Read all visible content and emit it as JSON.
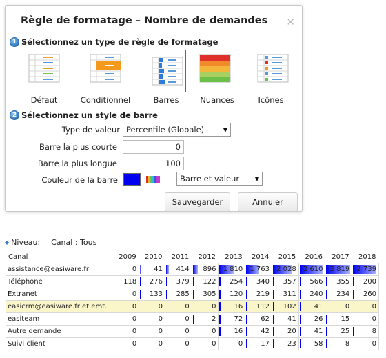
{
  "dialog": {
    "title": "Règle de formatage – Nombre de demandes",
    "close_glyph": "✕",
    "step1": {
      "num": "1",
      "label": "Sélectionnez un type de règle de formatage"
    },
    "step2": {
      "num": "2",
      "label": "Sélectionnez un style de barre"
    },
    "rule_types": [
      {
        "label": "Défaut",
        "icon": "default-format-icon"
      },
      {
        "label": "Conditionnel",
        "icon": "conditional-format-icon"
      },
      {
        "label": "Barres",
        "icon": "bars-format-icon",
        "selected": true
      },
      {
        "label": "Nuances",
        "icon": "shades-format-icon"
      },
      {
        "label": "Icônes",
        "icon": "icons-format-icon"
      }
    ],
    "value_type_label": "Type de valeur",
    "value_type": "Percentile (Globale)",
    "shortest_bar_label": "Barre la plus courte",
    "shortest_bar": "0",
    "longest_bar_label": "Barre la plus longue",
    "longest_bar": "100",
    "bar_color_label": "Couleur de la barre",
    "bar_color": "#0000f0",
    "display_mode": "Barre et valeur",
    "save_label": "Sauvegarder",
    "cancel_label": "Annuler"
  },
  "level": {
    "label": "Niveau:",
    "value": "Canal : Tous"
  },
  "table": {
    "header": [
      "Canal",
      "2009",
      "2010",
      "2011",
      "2012",
      "2013",
      "2014",
      "2015",
      "2016",
      "2017",
      "2018"
    ],
    "rows": [
      {
        "canal": "assistance@easiware.fr",
        "values": [
          "0",
          "41",
          "414",
          "896",
          "1 810",
          "1 763",
          "2 028",
          "2 610",
          "2 819",
          "2 739"
        ],
        "bars": [
          0,
          0.02,
          0.1,
          0.2,
          0.55,
          0.5,
          0.72,
          0.88,
          0.92,
          0.9
        ],
        "highlight": false
      },
      {
        "canal": "Téléphone",
        "values": [
          "118",
          "276",
          "379",
          "122",
          "254",
          "340",
          "357",
          "566",
          "355",
          "200"
        ],
        "bars": [
          0,
          0,
          0,
          0,
          0,
          0,
          0,
          0,
          0,
          0
        ],
        "highlight": false
      },
      {
        "canal": "Extranet",
        "values": [
          "0",
          "133",
          "285",
          "305",
          "120",
          "219",
          "311",
          "240",
          "234",
          "260"
        ],
        "bars": [
          0,
          0,
          0,
          0,
          0,
          0,
          0,
          0,
          0,
          0
        ],
        "highlight": false
      },
      {
        "canal": "easicrm@easiware.fr et emt.",
        "values": [
          "0",
          "0",
          "0",
          "0",
          "16",
          "112",
          "102",
          "41",
          "0",
          "0"
        ],
        "bars": [
          0,
          0,
          0,
          0,
          0,
          0,
          0,
          0,
          0,
          0
        ],
        "highlight": true
      },
      {
        "canal": "easiteam",
        "values": [
          "0",
          "0",
          "0",
          "2",
          "72",
          "62",
          "41",
          "26",
          "15",
          "0"
        ],
        "bars": [
          0,
          0,
          0,
          0,
          0,
          0,
          0,
          0,
          0,
          0
        ],
        "highlight": false
      },
      {
        "canal": "Autre demande",
        "values": [
          "0",
          "0",
          "0",
          "0",
          "16",
          "42",
          "20",
          "41",
          "25",
          "8"
        ],
        "bars": [
          0,
          0,
          0,
          0,
          0,
          0,
          0,
          0,
          0,
          0
        ],
        "highlight": false
      },
      {
        "canal": "Suivi client",
        "values": [
          "0",
          "0",
          "0",
          "0",
          "0",
          "17",
          "23",
          "58",
          "8",
          "0"
        ],
        "bars": [
          0,
          0,
          0,
          0,
          0,
          0,
          0,
          0,
          0,
          0
        ],
        "highlight": false
      }
    ]
  }
}
